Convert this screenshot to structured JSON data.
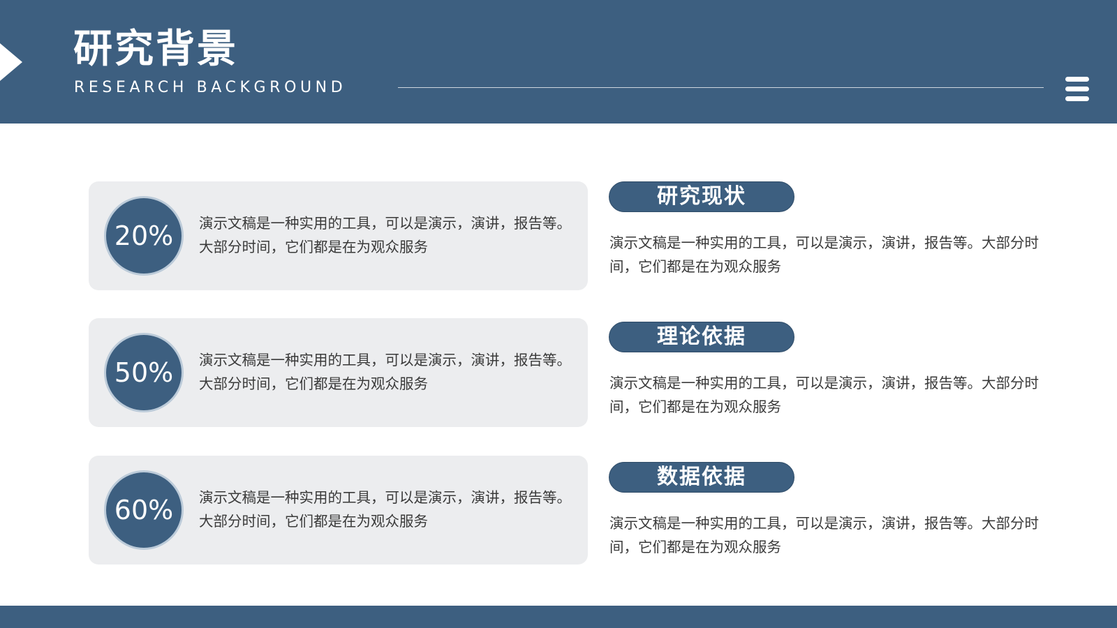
{
  "header": {
    "title": "研究背景",
    "subtitle": "RESEARCH BACKGROUND",
    "menu_icon": "hamburger-menu-icon",
    "arrow_icon": "right-triangle-icon"
  },
  "cards": [
    {
      "percent": "20%",
      "value": 20,
      "text": "演示文稿是一种实用的工具，可以是演示，演讲，报告等。大部分时间，它们都是在为观众服务"
    },
    {
      "percent": "50%",
      "value": 50,
      "text": "演示文稿是一种实用的工具，可以是演示，演讲，报告等。大部分时间，它们都是在为观众服务"
    },
    {
      "percent": "60%",
      "value": 60,
      "text": "演示文稿是一种实用的工具，可以是演示，演讲，报告等。大部分时间，它们都是在为观众服务"
    }
  ],
  "sections": [
    {
      "label": "研究现状",
      "text": "演示文稿是一种实用的工具，可以是演示，演讲，报告等。大部分时间，它们都是在为观众服务"
    },
    {
      "label": "理论依据",
      "text": "演示文稿是一种实用的工具，可以是演示，演讲，报告等。大部分时间，它们都是在为观众服务"
    },
    {
      "label": "数据依据",
      "text": "演示文稿是一种实用的工具，可以是演示，演讲，报告等。大部分时间，它们都是在为观众服务"
    }
  ],
  "colors": {
    "primary": "#3d5f80",
    "card_background": "#ecedef",
    "text": "#3a3a3a",
    "circle_ring": "#bccbd9"
  }
}
